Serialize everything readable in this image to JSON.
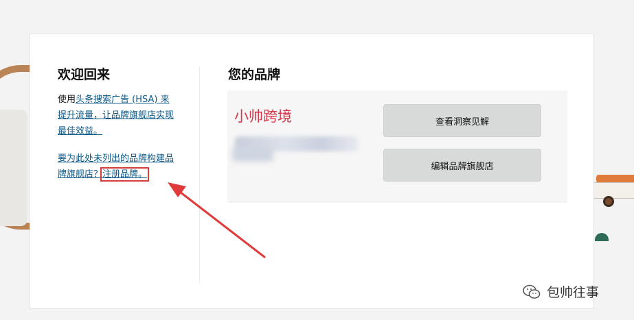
{
  "welcome": {
    "title": "欢迎回来",
    "text_prefix": "使用",
    "hsa_link": "头条搜索广告 (HSA) 来提升流量，让品牌旗舰店实现最佳效益。",
    "register_prefix": "要为此处未列出的品牌构建品牌旗舰店？",
    "register_link": "注册品牌。"
  },
  "brands": {
    "title": "您的品牌",
    "watermark": "小帅跨境",
    "insights_button": "查看洞察见解",
    "edit_button": "编辑品牌旗舰店"
  },
  "footer": {
    "account_name": "包帅往事",
    "icon": "wechat-icon"
  },
  "colors": {
    "link": "#0b5a8a",
    "highlight": "#d63c3c",
    "button_bg": "#d8dad9",
    "watermark": "#d8384a"
  }
}
